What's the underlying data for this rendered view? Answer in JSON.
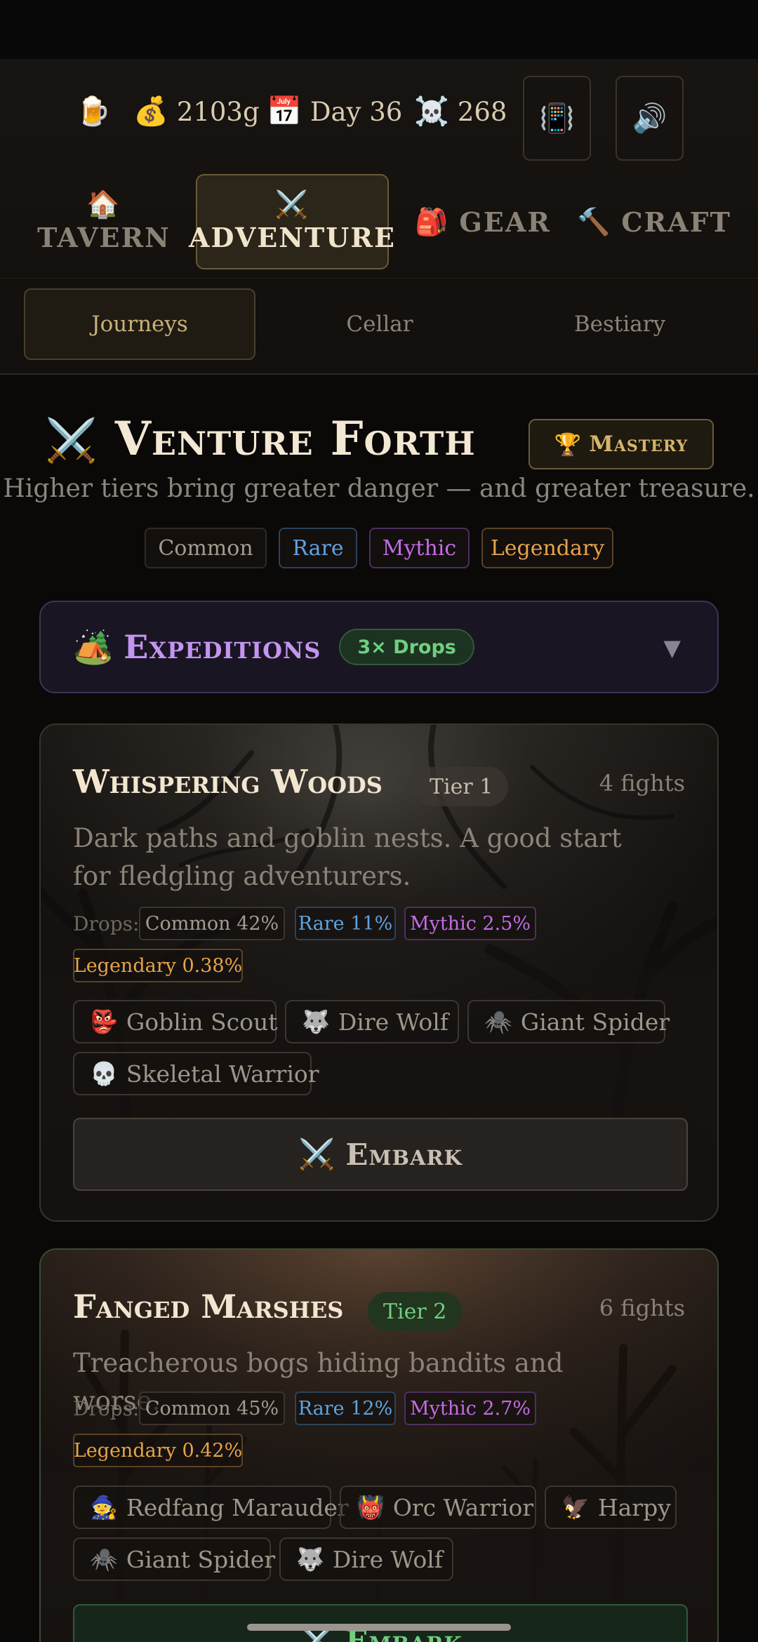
{
  "stats": {
    "ale_icon": "beer-mug-icon",
    "gold": "2103g",
    "day": "Day 36",
    "kills": "268"
  },
  "icon_buttons": [
    "vibrate-icon",
    "speaker-icon"
  ],
  "nav": {
    "tabs": [
      {
        "label": "TAVERN",
        "icon": "house-icon"
      },
      {
        "label": "ADVENTURE",
        "icon": "crossed-swords-icon"
      },
      {
        "label": "GEAR",
        "icon": "backpack-icon"
      },
      {
        "label": "CRAFT",
        "icon": "hammer-icon"
      }
    ],
    "active": "ADVENTURE"
  },
  "subtabs": [
    "Journeys",
    "Cellar",
    "Bestiary"
  ],
  "hero": {
    "title": "Venture Forth",
    "mastery": "Mastery",
    "subtitle": "Higher tiers bring greater danger — and greater treasure."
  },
  "rarities": [
    "Common",
    "Rare",
    "Mythic",
    "Legendary"
  ],
  "expeditions": {
    "title": "Expeditions",
    "badge": "3× Drops"
  },
  "cards": [
    {
      "title": "Whispering Woods",
      "tier": "Tier 1",
      "fights": "4 fights",
      "desc": "Dark paths and goblin nests. A good start for fledgling adventurers.",
      "drops_label": "Drops:",
      "drops": [
        "Common 42%",
        "Rare 11%",
        "Mythic 2.5%",
        "Legendary 0.38%"
      ],
      "enemies": [
        "Goblin Scout",
        "Dire Wolf",
        "Giant Spider",
        "Skeletal Warrior"
      ],
      "embark": "Embark"
    },
    {
      "title": "Fanged Marshes",
      "tier": "Tier 2",
      "fights": "6 fights",
      "desc": "Treacherous bogs hiding bandits and worse.",
      "drops_label": "Drops:",
      "drops": [
        "Common 45%",
        "Rare 12%",
        "Mythic 2.7%",
        "Legendary 0.42%"
      ],
      "enemies": [
        "Redfang Marauder",
        "Orc Warrior",
        "Harpy",
        "Giant Spider",
        "Dire Wolf"
      ],
      "embark": "Embark"
    }
  ],
  "colors": {
    "common": "#a39c90",
    "rare": "#5fa3e0",
    "mythic": "#c56be6",
    "legendary": "#e8a34a",
    "accent_gold": "#d6b56a",
    "expedition_purple": "#c295f0",
    "tier2_green": "#6fcf7f"
  }
}
